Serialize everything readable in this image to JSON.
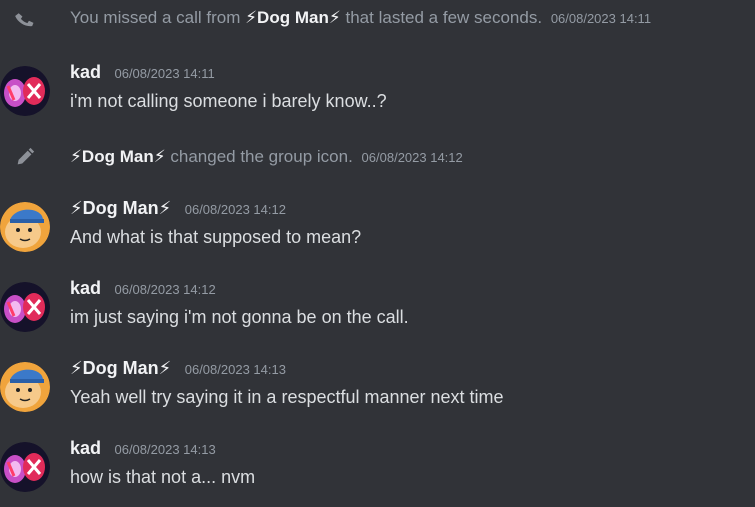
{
  "call_notice": {
    "prefix": "You missed a call from ",
    "caller": "⚡Dog Man⚡",
    "suffix": " that lasted a few seconds.",
    "timestamp": "06/08/2023 14:11",
    "icon": "phone-missed-icon"
  },
  "messages": [
    {
      "author": "kad",
      "timestamp": "06/08/2023 14:11",
      "text": "i'm not calling someone i barely know..?",
      "avatar": "kad-avatar"
    },
    {
      "author": "⚡Dog Man⚡",
      "timestamp": "06/08/2023 14:12",
      "text": "And what is that supposed to mean?",
      "avatar": "dogman-avatar"
    },
    {
      "author": "kad",
      "timestamp": "06/08/2023 14:12",
      "text": "im just saying i'm not gonna be on the call.",
      "avatar": "kad-avatar"
    },
    {
      "author": "⚡Dog Man⚡",
      "timestamp": "06/08/2023 14:13",
      "text": "Yeah well try saying it in a respectful manner next time",
      "avatar": "dogman-avatar"
    },
    {
      "author": "kad",
      "timestamp": "06/08/2023 14:13",
      "text": "how is that not a... nvm",
      "avatar": "kad-avatar"
    }
  ],
  "icon_change_notice": {
    "actor": "⚡Dog Man⚡",
    "text": " changed the group icon.",
    "timestamp": "06/08/2023 14:12",
    "icon": "pencil-icon"
  },
  "colors": {
    "background": "#313338",
    "text": "#dbdee1",
    "muted": "#949ba4",
    "author": "#f2f3f5"
  }
}
